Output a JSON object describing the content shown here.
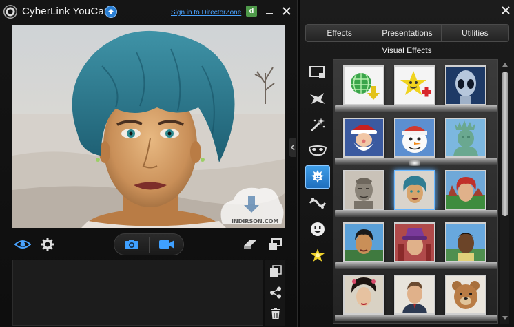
{
  "window": {
    "app_title": "CyberLink YouCam",
    "signin_link": "Sign in to DirectorZone",
    "dz_badge": "d"
  },
  "preview": {
    "watermark_text": "INDIRSON.COM"
  },
  "controls": {
    "icons": [
      "eye-icon",
      "gear-icon",
      "camera-icon",
      "video-camera-icon",
      "eraser-icon",
      "dual-screen-icon"
    ]
  },
  "library_side": {
    "icons": [
      "export-icon",
      "share-icon",
      "trash-icon"
    ]
  },
  "right_panel": {
    "tabs": [
      {
        "label": "Effects"
      },
      {
        "label": "Presentations"
      },
      {
        "label": "Utilities"
      }
    ],
    "section_title": "Visual Effects",
    "categories": [
      "frame-icon",
      "particle-icon",
      "magic-wand-icon",
      "mask-icon",
      "avatar-icon",
      "splash-icon",
      "emoticon-icon",
      "sparkle-icon"
    ],
    "active_category": 4,
    "tile_rows": [
      [
        "globe-download",
        "star-add",
        "alien"
      ],
      [
        "santa",
        "snowman",
        "statue-of-liberty"
      ],
      [
        "terracotta-warrior",
        "teal-hair-avatar",
        "red-hair-avatar"
      ],
      [
        "black-hair-avatar",
        "purple-hat-avatar",
        "dark-skin-avatar"
      ],
      [
        "geisha-avatar",
        "suit-avatar",
        "teddy-bear"
      ]
    ],
    "selected_tile": "teal-hair-avatar"
  },
  "colors": {
    "accent": "#2a8cff",
    "background": "#111111",
    "link": "#4aa3ff"
  }
}
